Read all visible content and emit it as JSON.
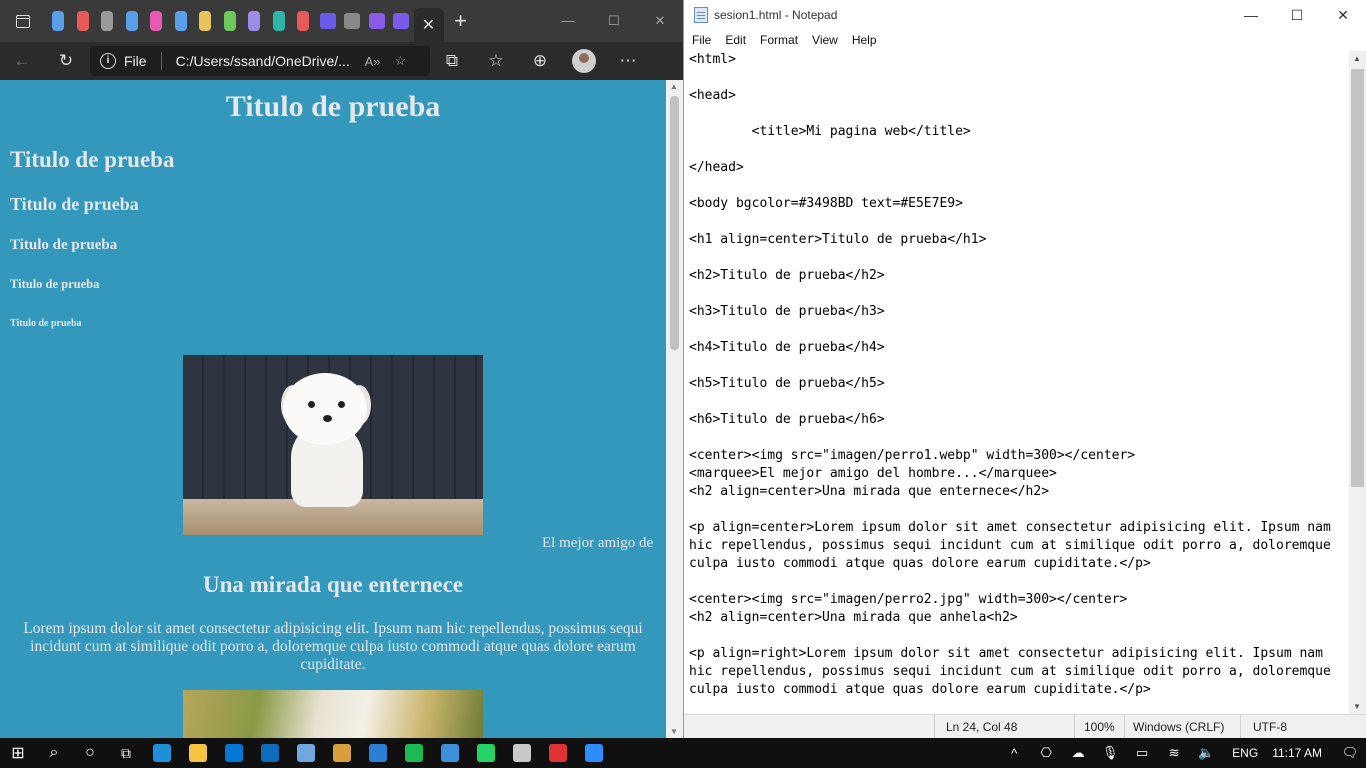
{
  "browser": {
    "address": {
      "scheme_label": "File",
      "url": "C:/Users/ssand/OneDrive/...",
      "read_aloud": "A̅"
    },
    "tab_colors": [
      "#5aa0e8",
      "#e85a5a",
      "#9a9a9a",
      "#5aa0e8",
      "#e85ab5",
      "#5aa0e8",
      "#e8c35a",
      "#6fc95a",
      "#a08ae8",
      "#2fb5a8",
      "#e85a5a",
      "#6a5ae8",
      "#888888",
      "#8a5ae8",
      "#7a5ae8"
    ],
    "new_tab": "+",
    "page": {
      "h1": "Titulo de prueba",
      "h2": "Titulo de prueba",
      "h3": "Titulo de prueba",
      "h4": "Titulo de prueba",
      "h5": "Titulo de prueba",
      "h6": "Titulo de prueba",
      "marquee": "El mejor amigo de",
      "h2_center": "Una mirada que enternece",
      "paragraph": "Lorem ipsum dolor sit amet consectetur adipisicing elit. Ipsum nam hic repellendus, possimus sequi incidunt cum at similique odit porro a, doloremque culpa iusto commodi atque quas dolore earum cupiditate."
    }
  },
  "notepad": {
    "title": "sesion1.html - Notepad",
    "menu": [
      "File",
      "Edit",
      "Format",
      "View",
      "Help"
    ],
    "content": "<html>\n\n<head>\n\n        <title>Mi pagina web</title>\n\n</head>\n\n<body bgcolor=#3498BD text=#E5E7E9>\n\n<h1 align=center>Titulo de prueba</h1>\n\n<h2>Titulo de prueba</h2>\n\n<h3>Titulo de prueba</h3>\n\n<h4>Titulo de prueba</h4>\n\n<h5>Titulo de prueba</h5>\n\n<h6>Titulo de prueba</h6>\n\n<center><img src=\"imagen/perro1.webp\" width=300></center>\n<marquee>El mejor amigo del hombre...</marquee>\n<h2 align=center>Una mirada que enternece</h2>\n\n<p align=center>Lorem ipsum dolor sit amet consectetur adipisicing elit. Ipsum nam\nhic repellendus, possimus sequi incidunt cum at similique odit porro a, doloremque\nculpa iusto commodi atque quas dolore earum cupiditate.</p>\n\n<center><img src=\"imagen/perro2.jpg\" width=300></center>\n<h2 align=center>Una mirada que anhela<h2>\n\n<p align=right>Lorem ipsum dolor sit amet consectetur adipisicing elit. Ipsum nam\nhic repellendus, possimus sequi incidunt cum at similique odit porro a, doloremque\nculpa iusto commodi atque quas dolore earum cupiditate.</p>",
    "status": {
      "position": "Ln 24, Col 48",
      "zoom": "100%",
      "line_endings": "Windows (CRLF)",
      "encoding": "UTF-8"
    }
  },
  "taskbar": {
    "app_colors": [
      "#1f8fd9",
      "#f5c542",
      "#0078d4",
      "#0f6cbd",
      "#6fa8dc",
      "#d8a03a",
      "#2d7fd6",
      "#1db954",
      "#3c8fd8",
      "#25d366",
      "#c9c9c9",
      "#d33",
      "#2d8cff"
    ],
    "language": "ENG",
    "time": "11:17 AM"
  },
  "colors": {
    "page_bg": "#3498BD",
    "page_text": "#E5E7E9"
  }
}
